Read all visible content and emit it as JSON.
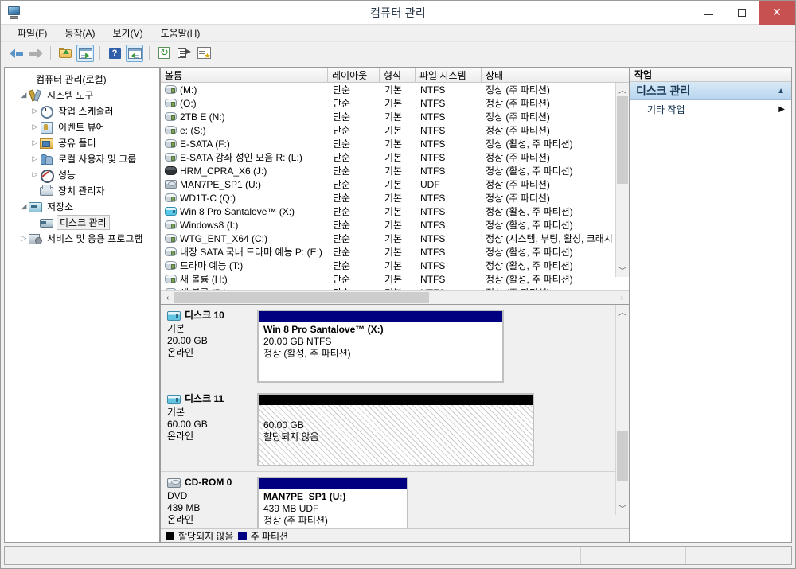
{
  "window": {
    "title": "컴퓨터 관리",
    "app_icon": "computer-management-icon",
    "minimize": "–",
    "maximize": "□",
    "close": "✕"
  },
  "menu": {
    "items": [
      {
        "label": "파일(F)"
      },
      {
        "label": "동작(A)"
      },
      {
        "label": "보기(V)"
      },
      {
        "label": "도움말(H)"
      }
    ]
  },
  "toolbar": {
    "buttons": [
      {
        "name": "back-icon"
      },
      {
        "name": "forward-icon"
      },
      {
        "name": "up-folder-icon"
      },
      {
        "name": "show-console-tree-icon"
      },
      {
        "name": "help-icon"
      },
      {
        "name": "show-action-pane-icon"
      },
      {
        "name": "refresh-icon"
      },
      {
        "name": "export-list-icon"
      },
      {
        "name": "properties-icon"
      }
    ]
  },
  "tree": {
    "nodes": [
      {
        "label": "컴퓨터 관리(로컬)",
        "indent": 0,
        "expander": "",
        "icon": "ic-computer",
        "selected": false
      },
      {
        "label": "시스템 도구",
        "indent": 1,
        "expander": "◢",
        "icon": "ic-tools",
        "selected": false
      },
      {
        "label": "작업 스케줄러",
        "indent": 2,
        "expander": "▷",
        "icon": "ic-clock",
        "selected": false
      },
      {
        "label": "이벤트 뷰어",
        "indent": 2,
        "expander": "▷",
        "icon": "ic-event",
        "selected": false
      },
      {
        "label": "공유 폴더",
        "indent": 2,
        "expander": "▷",
        "icon": "ic-share",
        "selected": false
      },
      {
        "label": "로컬 사용자 및 그룹",
        "indent": 2,
        "expander": "▷",
        "icon": "ic-users",
        "selected": false
      },
      {
        "label": "성능",
        "indent": 2,
        "expander": "▷",
        "icon": "ic-perf",
        "selected": false
      },
      {
        "label": "장치 관리자",
        "indent": 2,
        "expander": "",
        "icon": "ic-device",
        "selected": false
      },
      {
        "label": "저장소",
        "indent": 1,
        "expander": "◢",
        "icon": "ic-storage",
        "selected": false
      },
      {
        "label": "디스크 관리",
        "indent": 2,
        "expander": "",
        "icon": "ic-diskmgmt",
        "selected": true
      },
      {
        "label": "서비스 및 응용 프로그램",
        "indent": 1,
        "expander": "▷",
        "icon": "ic-services",
        "selected": false
      }
    ]
  },
  "volume_list": {
    "columns": [
      "볼륨",
      "레이아웃",
      "형식",
      "파일 시스템",
      "상태"
    ],
    "rows": [
      {
        "icon": "hdd",
        "volume": "(M:)",
        "layout": "단순",
        "type": "기본",
        "fs": "NTFS",
        "status": "정상 (주 파티션)"
      },
      {
        "icon": "hdd",
        "volume": "(O:)",
        "layout": "단순",
        "type": "기본",
        "fs": "NTFS",
        "status": "정상 (주 파티션)"
      },
      {
        "icon": "hdd",
        "volume": "2TB E (N:)",
        "layout": "단순",
        "type": "기본",
        "fs": "NTFS",
        "status": "정상 (주 파티션)"
      },
      {
        "icon": "hdd",
        "volume": "e: (S:)",
        "layout": "단순",
        "type": "기본",
        "fs": "NTFS",
        "status": "정상 (주 파티션)"
      },
      {
        "icon": "hdd",
        "volume": "E-SATA (F:)",
        "layout": "단순",
        "type": "기본",
        "fs": "NTFS",
        "status": "정상 (활성, 주 파티션)"
      },
      {
        "icon": "hdd",
        "volume": "E-SATA 강좌 성인 모음 R: (L:)",
        "layout": "단순",
        "type": "기본",
        "fs": "NTFS",
        "status": "정상 (주 파티션)"
      },
      {
        "icon": "hdd-dark",
        "volume": "HRM_CPRA_X6 (J:)",
        "layout": "단순",
        "type": "기본",
        "fs": "NTFS",
        "status": "정상 (활성, 주 파티션)"
      },
      {
        "icon": "cd",
        "volume": "MAN7PE_SP1 (U:)",
        "layout": "단순",
        "type": "기본",
        "fs": "UDF",
        "status": "정상 (주 파티션)"
      },
      {
        "icon": "hdd",
        "volume": "WD1T-C (Q:)",
        "layout": "단순",
        "type": "기본",
        "fs": "NTFS",
        "status": "정상 (주 파티션)"
      },
      {
        "icon": "hdd-sel",
        "volume": "Win 8 Pro Santalove™ (X:)",
        "layout": "단순",
        "type": "기본",
        "fs": "NTFS",
        "status": "정상 (활성, 주 파티션)"
      },
      {
        "icon": "hdd",
        "volume": "Windows8 (I:)",
        "layout": "단순",
        "type": "기본",
        "fs": "NTFS",
        "status": "정상 (활성, 주 파티션)"
      },
      {
        "icon": "hdd",
        "volume": "WTG_ENT_X64 (C:)",
        "layout": "단순",
        "type": "기본",
        "fs": "NTFS",
        "status": "정상 (시스템, 부팅, 활성, 크래시"
      },
      {
        "icon": "hdd",
        "volume": "내장 SATA 국내 드라마 예능 P: (E:)",
        "layout": "단순",
        "type": "기본",
        "fs": "NTFS",
        "status": "정상 (활성, 주 파티션)"
      },
      {
        "icon": "hdd",
        "volume": "드라마 예능 (T:)",
        "layout": "단순",
        "type": "기본",
        "fs": "NTFS",
        "status": "정상 (활성, 주 파티션)"
      },
      {
        "icon": "hdd",
        "volume": "새 볼륨 (H:)",
        "layout": "단순",
        "type": "기본",
        "fs": "NTFS",
        "status": "정상 (활성, 주 파티션)"
      },
      {
        "icon": "hdd",
        "volume": "새 볼륨 (P:)",
        "layout": "단순",
        "type": "기본",
        "fs": "NTFS",
        "status": "정상 (주 파티션)"
      }
    ],
    "scroll_up": "︿",
    "scroll_down": "﹀",
    "scroll_left": "‹",
    "scroll_right": "›"
  },
  "disks": [
    {
      "name": "디스크 10",
      "icon": "hd",
      "type": "기본",
      "size": "20.00 GB",
      "state": "온라인",
      "partition": {
        "bar": "blue",
        "name": "Win 8 Pro Santalove™  (X:)",
        "size": "20.00 GB NTFS",
        "status": "정상 (활성, 주 파티션)",
        "unallocated": false
      }
    },
    {
      "name": "디스크 11",
      "icon": "hd",
      "type": "기본",
      "size": "60.00 GB",
      "state": "온라인",
      "partition": {
        "bar": "black",
        "name": "",
        "size": "60.00 GB",
        "status": "할당되지 않음",
        "unallocated": true
      }
    },
    {
      "name": "CD-ROM 0",
      "icon": "cdrom",
      "type": "DVD",
      "size": "439 MB",
      "state": "온라인",
      "partition": {
        "bar": "blue",
        "name": "MAN7PE_SP1  (U:)",
        "size": "439 MB UDF",
        "status": "정상 (주 파티션)",
        "unallocated": false
      }
    }
  ],
  "legend": [
    {
      "color": "#000000",
      "label": "할당되지 않음"
    },
    {
      "color": "#000080",
      "label": "주 파티션"
    }
  ],
  "actions": {
    "header": "작업",
    "title": "디스크 관리",
    "collapse_caret": "▲",
    "items": [
      {
        "label": "기타 작업",
        "caret": "▶"
      }
    ]
  },
  "statusbar": {
    "main": "",
    "pane_a": "",
    "pane_b": ""
  }
}
